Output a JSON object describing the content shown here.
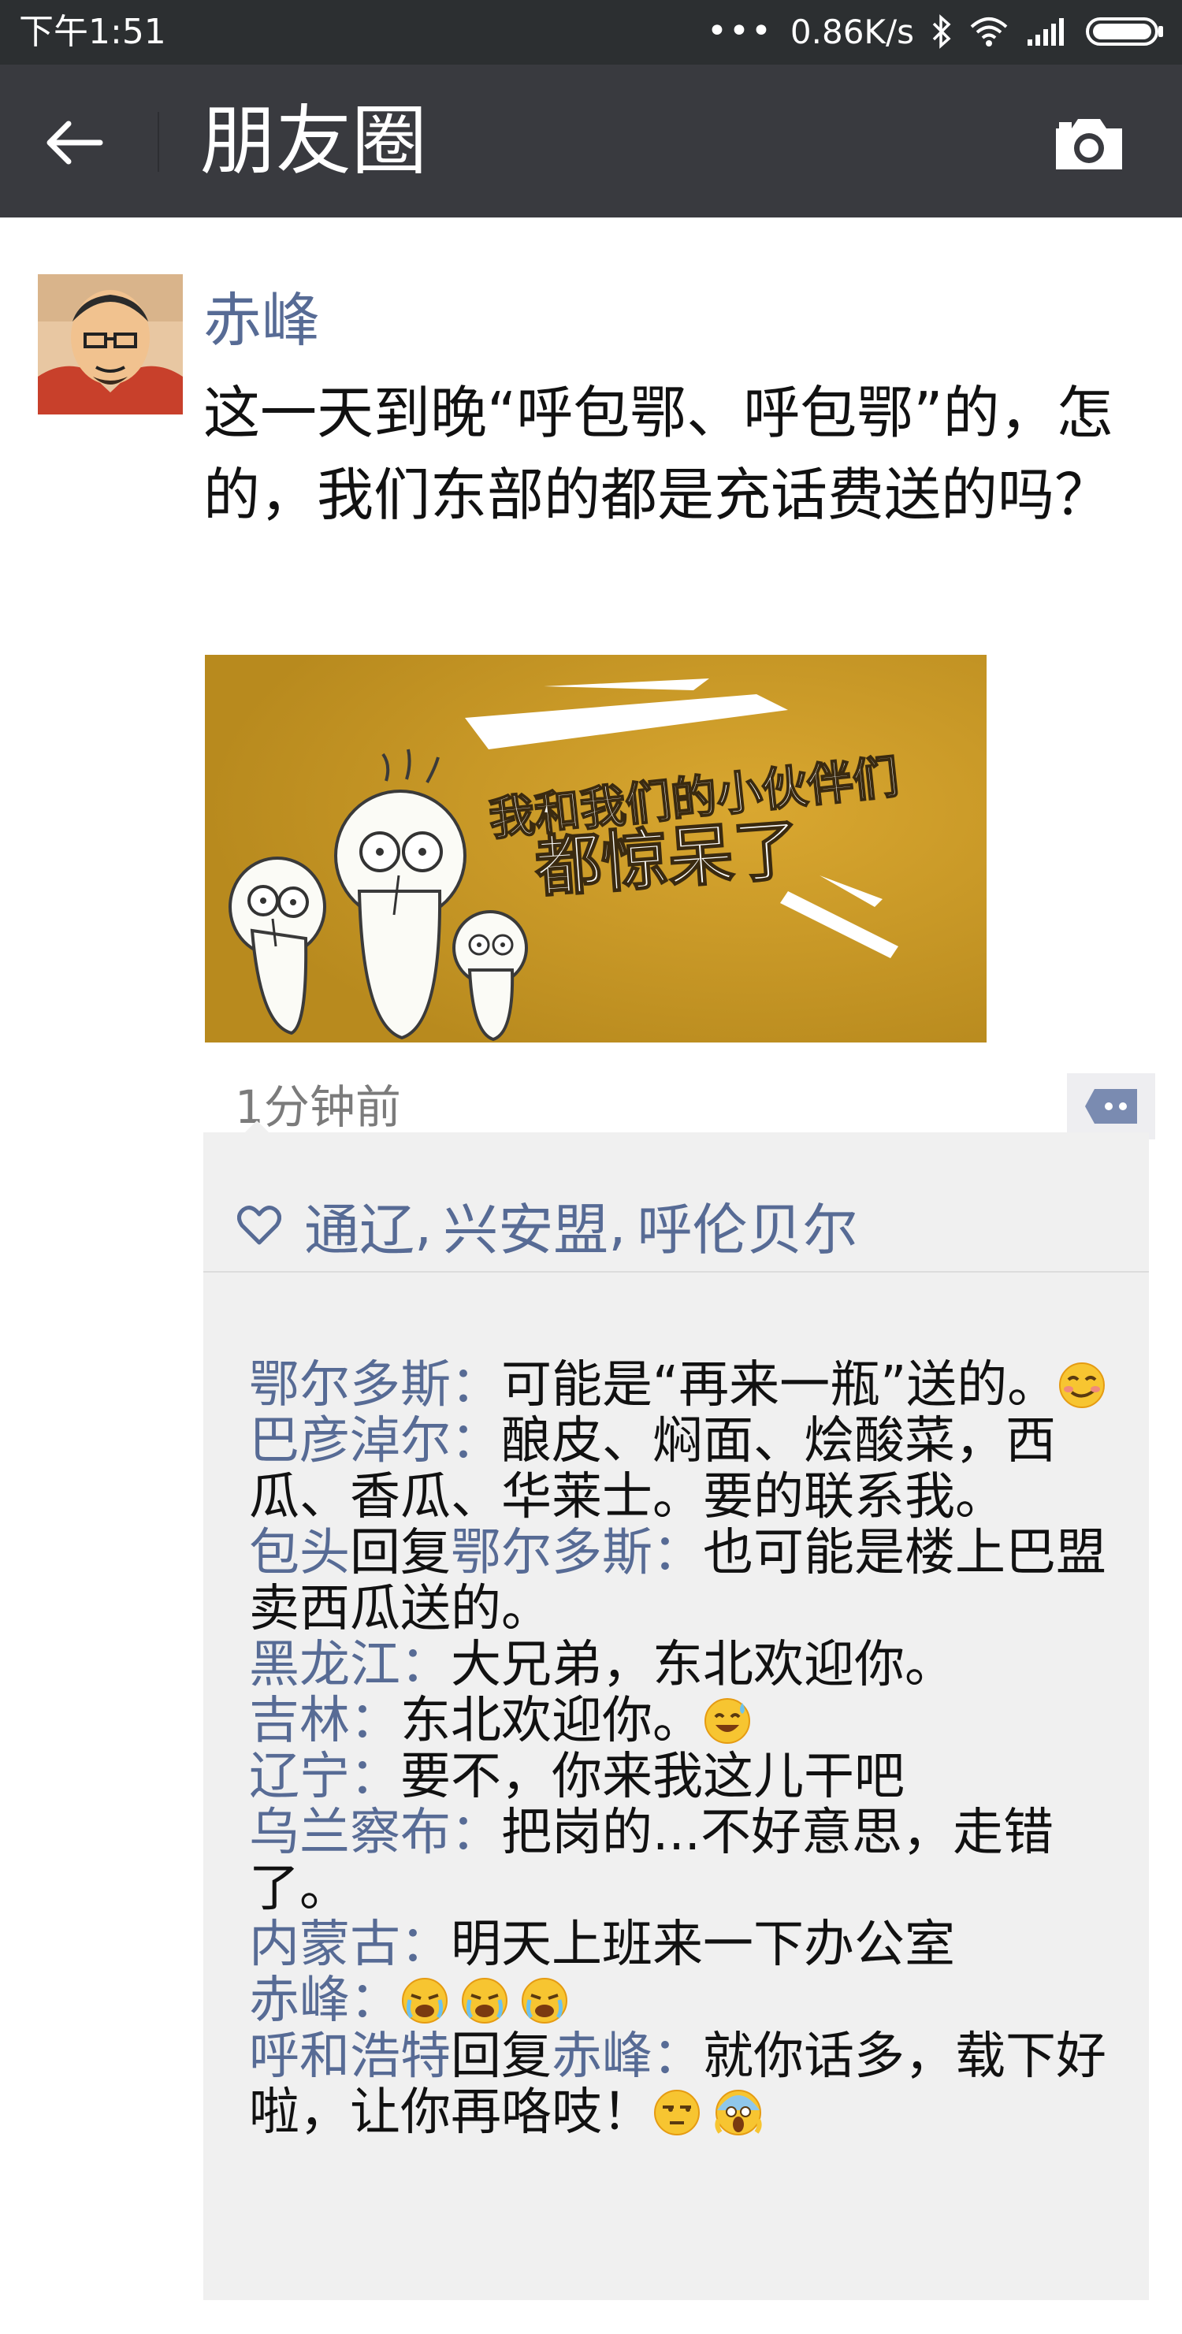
{
  "status_bar": {
    "time": "下午1:51",
    "dots": "•••",
    "speed": "0.86K/s"
  },
  "title_bar": {
    "title": "朋友圈"
  },
  "post": {
    "author": "赤峰",
    "text": "这一天到晚“呼包鄂、呼包鄂”的，怎的，我们东部的都是充话费送的吗？",
    "image_text": [
      "我和我们的小伙伴们",
      "都惊呆了"
    ],
    "time": "1分钟前"
  },
  "likes": [
    "通辽",
    "兴安盟",
    "呼伦贝尔"
  ],
  "like_separator": ",",
  "reply_word": "回复",
  "colon": "：",
  "comments": [
    {
      "name": "鄂尔多斯",
      "text": "可能是“再来一瓶”送的。",
      "emoji": [
        "smirk"
      ]
    },
    {
      "name": "巴彦淖尔",
      "text": "酿皮、焖面、烩酸菜，西瓜、香瓜、华莱士。要的联系我。",
      "emoji": []
    },
    {
      "name": "包头",
      "reply_to": "鄂尔多斯",
      "text": "也可能是楼上巴盟卖西瓜送的。",
      "emoji": []
    },
    {
      "name": "黑龙江",
      "text": "大兄弟，东北欢迎你。",
      "emoji": []
    },
    {
      "name": "吉林",
      "text": "东北欢迎你。",
      "emoji": [
        "sweat-smile"
      ]
    },
    {
      "name": "辽宁",
      "text": "要不，你来我这儿干吧",
      "emoji": []
    },
    {
      "name": "乌兰察布",
      "text": "把岗的...不好意思，走错了。",
      "emoji": []
    },
    {
      "name": "内蒙古",
      "text": "明天上班来一下办公室",
      "emoji": []
    },
    {
      "name": "赤峰",
      "text": "",
      "emoji": [
        "crying",
        "crying",
        "crying"
      ]
    },
    {
      "name": "呼和浩特",
      "reply_to": "赤峰",
      "text": "就你话多，载下好啦，让你再咯吱！",
      "emoji": [
        "unamused",
        "scream"
      ]
    }
  ],
  "colors": {
    "status_bg": "#2c2f31",
    "title_bg": "#393a3f",
    "link": "#576b95",
    "panel_bg": "#f0f0f0",
    "image_bg": "#c99c24"
  }
}
